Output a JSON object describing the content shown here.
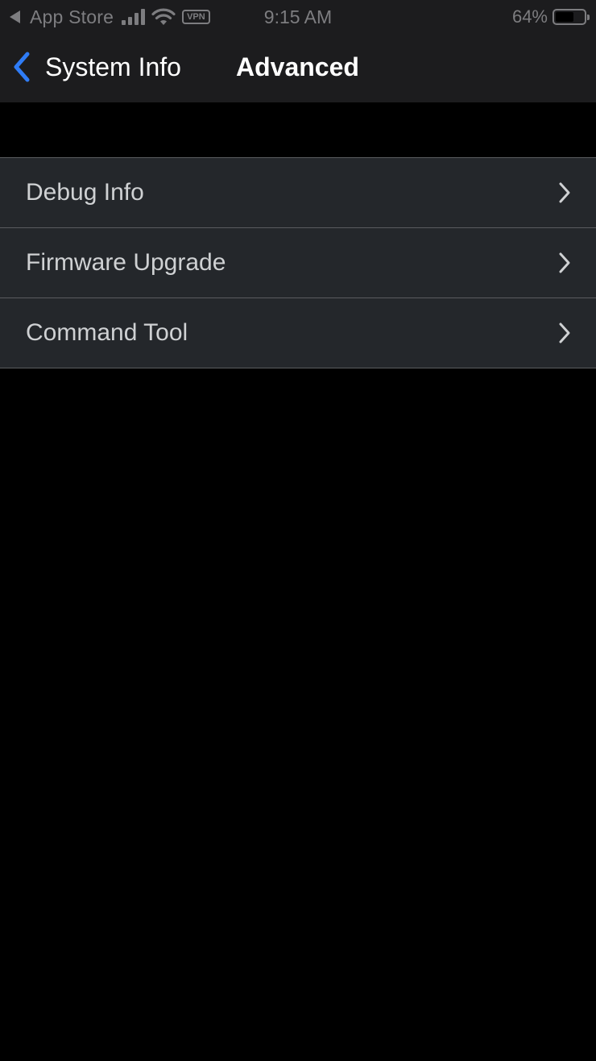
{
  "status_bar": {
    "back_app": "App Store",
    "vpn": "VPN",
    "time": "9:15 AM",
    "battery_percent": "64%",
    "battery_level": 0.64,
    "icons": [
      "back-triangle-icon",
      "cellular-signal-icon",
      "wifi-icon",
      "battery-icon"
    ]
  },
  "nav": {
    "back_label": "System Info",
    "title": "Advanced",
    "accent_color": "#2f7cf6"
  },
  "list": {
    "items": [
      {
        "label": "Debug Info"
      },
      {
        "label": "Firmware Upgrade"
      },
      {
        "label": "Command Tool"
      }
    ]
  },
  "colors": {
    "background": "#000000",
    "header": "#1c1c1e",
    "row": "#24272b",
    "row_text": "#cfd1d3",
    "separator": "#5a5c5f"
  }
}
